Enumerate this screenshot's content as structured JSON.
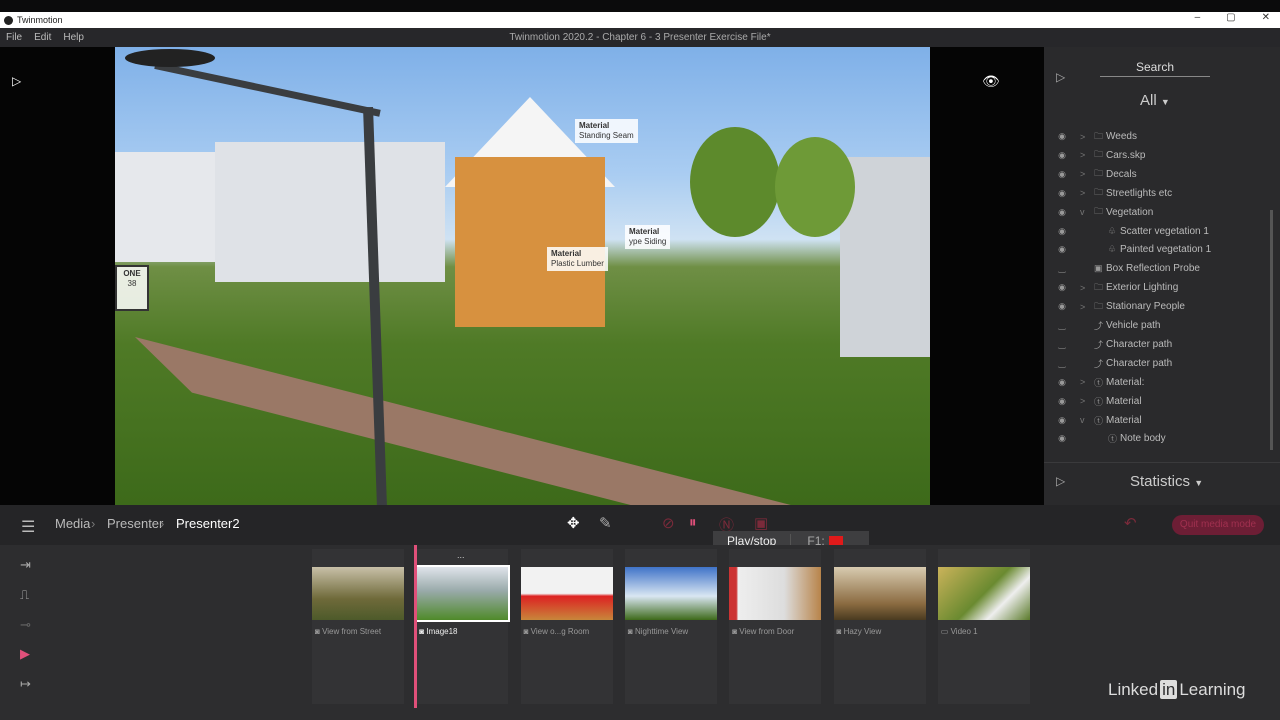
{
  "window": {
    "app_name": "Twinmotion",
    "doc_title": "Twinmotion 2020.2 - Chapter 6 - 3 Presenter Exercise File*",
    "minimize": "–",
    "maximize": "▢",
    "close": "✕"
  },
  "menu": [
    "File",
    "Edit",
    "Help"
  ],
  "viewport": {
    "annotations": [
      {
        "title": "Material",
        "text": "Standing Seam"
      },
      {
        "title": "Material",
        "text": "Plastic Lumber"
      },
      {
        "title": "Material",
        "text": "ype Siding"
      }
    ],
    "sign_text": "ONE",
    "sign_num": "38"
  },
  "right_panel": {
    "search": "Search",
    "filter": "All",
    "statistics": "Statistics",
    "items": [
      {
        "label": "Weeds",
        "icon": "folder",
        "chev": ">",
        "indent": 0,
        "visible": true
      },
      {
        "label": "Cars.skp",
        "icon": "folder",
        "chev": ">",
        "indent": 0,
        "visible": true
      },
      {
        "label": "Decals",
        "icon": "folder",
        "chev": ">",
        "indent": 0,
        "visible": true
      },
      {
        "label": "Streetlights etc",
        "icon": "folder",
        "chev": ">",
        "indent": 0,
        "visible": true
      },
      {
        "label": "Vegetation",
        "icon": "folder",
        "chev": "v",
        "indent": 0,
        "visible": true
      },
      {
        "label": "Scatter vegetation 1",
        "icon": "vegetation",
        "chev": "",
        "indent": 1,
        "visible": true
      },
      {
        "label": "Painted vegetation 1",
        "icon": "vegetation",
        "chev": "",
        "indent": 1,
        "visible": true
      },
      {
        "label": "Box Reflection Probe",
        "icon": "probe",
        "chev": "",
        "indent": 0,
        "visible": false
      },
      {
        "label": "Exterior Lighting",
        "icon": "folder",
        "chev": ">",
        "indent": 0,
        "visible": true
      },
      {
        "label": "Stationary People",
        "icon": "folder",
        "chev": ">",
        "indent": 0,
        "visible": true
      },
      {
        "label": "Vehicle path",
        "icon": "path",
        "chev": "",
        "indent": 0,
        "visible": false
      },
      {
        "label": "Character path",
        "icon": "path",
        "chev": "",
        "indent": 0,
        "visible": false
      },
      {
        "label": "Character path",
        "icon": "path",
        "chev": "",
        "indent": 0,
        "visible": false
      },
      {
        "label": "Material:",
        "icon": "note",
        "chev": ">",
        "indent": 0,
        "visible": true
      },
      {
        "label": "Material",
        "icon": "note",
        "chev": ">",
        "indent": 0,
        "visible": true
      },
      {
        "label": "Material",
        "icon": "note",
        "chev": "v",
        "indent": 0,
        "visible": true
      },
      {
        "label": "Note body",
        "icon": "note",
        "chev": "",
        "indent": 1,
        "visible": true
      }
    ]
  },
  "breadcrumb": [
    "Media",
    "Presenter",
    "Presenter2"
  ],
  "tooltip": {
    "label": "Play/stop",
    "key": "F1:"
  },
  "quit_button": "Quit media mode",
  "timeline": {
    "more": "...",
    "items": [
      {
        "label": "View from Street",
        "type": "image"
      },
      {
        "label": "Image18",
        "type": "image",
        "selected": true
      },
      {
        "label": "View o...g Room",
        "type": "image"
      },
      {
        "label": "Nighttime View",
        "type": "image"
      },
      {
        "label": "View from Door",
        "type": "image"
      },
      {
        "label": "Hazy View",
        "type": "image"
      },
      {
        "label": "Video 1",
        "type": "video"
      }
    ]
  },
  "branding": {
    "linkedin_a": "Linked",
    "linkedin_in": "in",
    "linkedin_b": "Learning"
  },
  "colors": {
    "accent": "#e0507a",
    "quit_bg": "#6d1e35"
  }
}
